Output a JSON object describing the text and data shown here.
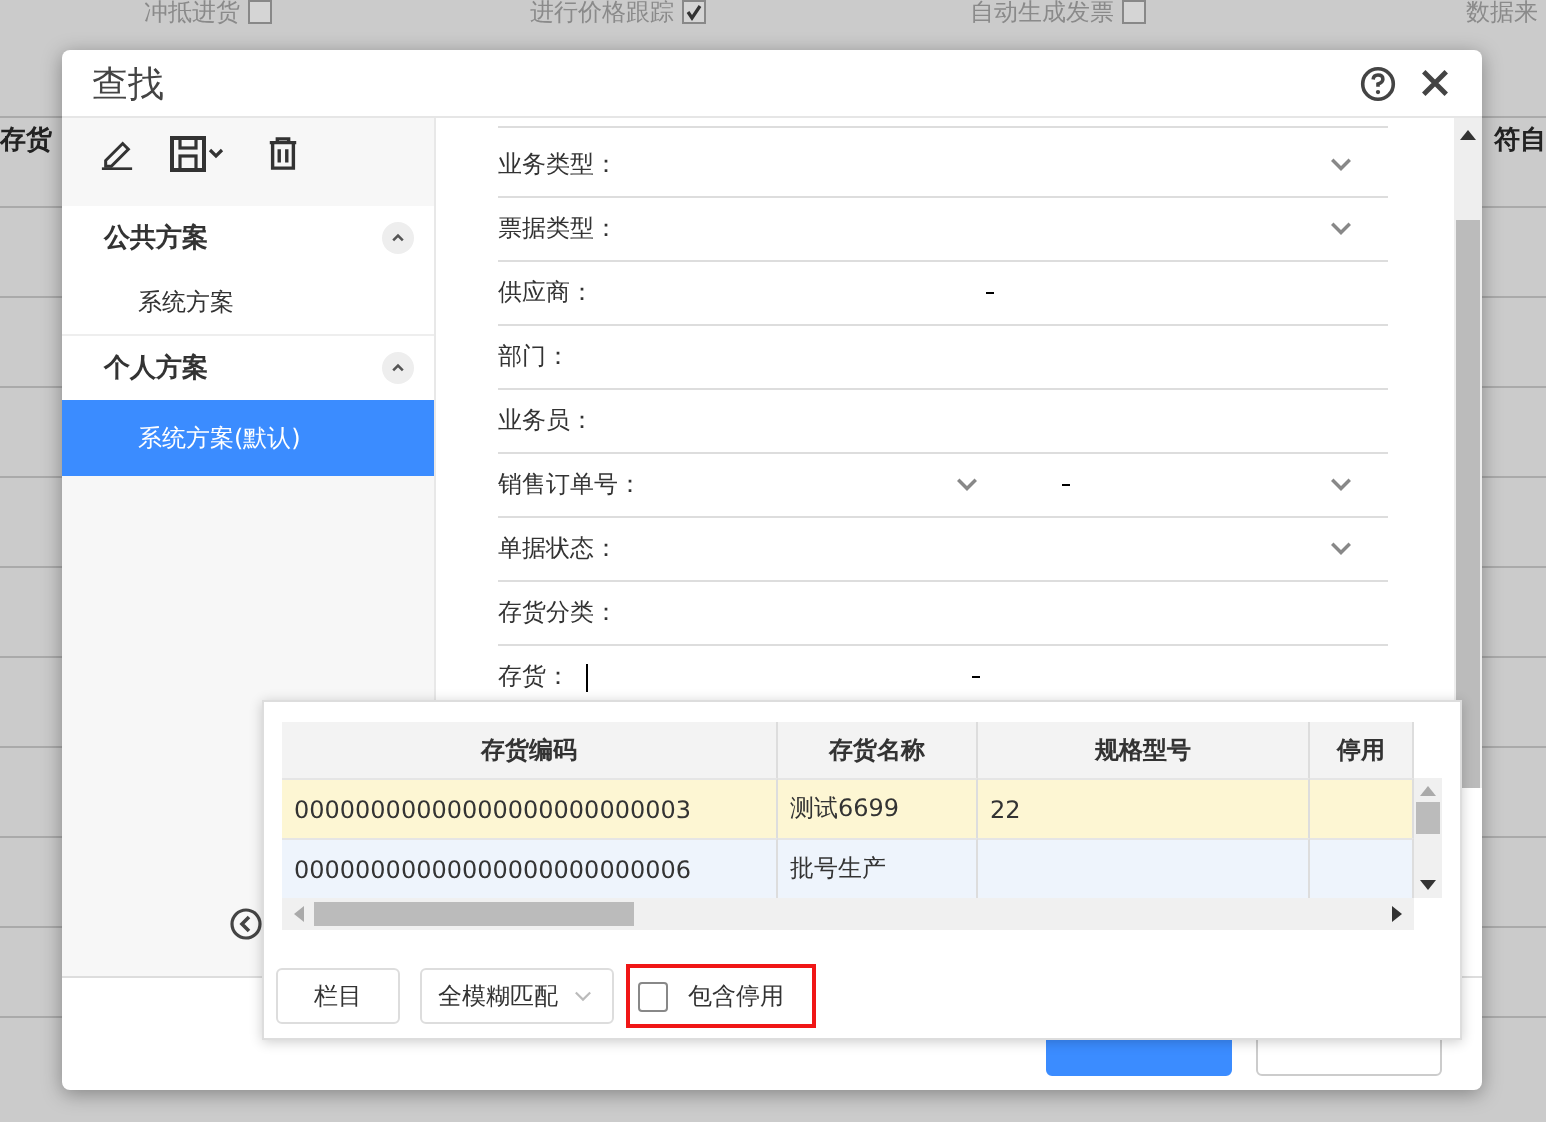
{
  "background": {
    "options": [
      {
        "label": "冲抵进货",
        "checked": false
      },
      {
        "label": "进行价格跟踪",
        "checked": true
      },
      {
        "label": "自动生成发票",
        "checked": false
      },
      {
        "label": "数据来"
      }
    ],
    "columns": [
      "存货",
      "符自"
    ]
  },
  "dialog": {
    "title": "查找",
    "sidebar": {
      "groups": [
        {
          "title": "公共方案",
          "expanded": true,
          "items": [
            {
              "label": "系统方案",
              "selected": false
            }
          ]
        },
        {
          "title": "个人方案",
          "expanded": true,
          "items": [
            {
              "label": "系统方案(默认)",
              "selected": true
            }
          ]
        }
      ]
    },
    "fields": [
      {
        "label": "业务类型：",
        "kind": "select"
      },
      {
        "label": "票据类型：",
        "kind": "select"
      },
      {
        "label": "供应商：",
        "kind": "range"
      },
      {
        "label": "部门：",
        "kind": "text"
      },
      {
        "label": "业务员：",
        "kind": "text"
      },
      {
        "label": "销售订单号：",
        "kind": "select-range"
      },
      {
        "label": "单据状态：",
        "kind": "select"
      },
      {
        "label": "存货分类：",
        "kind": "text"
      },
      {
        "label": "存货：",
        "kind": "focused-range"
      }
    ],
    "footer_buttons": [
      {
        "kind": "primary"
      },
      {
        "kind": "default"
      }
    ]
  },
  "popup": {
    "columns": [
      "存货编码",
      "存货名称",
      "规格型号",
      "停用"
    ],
    "rows": [
      {
        "cells": [
          "00000000000000000000000003",
          "测试6699",
          "22"
        ],
        "selected": true
      },
      {
        "cells": [
          "00000000000000000000000006",
          "批号生产"
        ],
        "selected": false
      }
    ],
    "columns_button": "栏目",
    "match_mode": "全模糊匹配",
    "include_disabled": {
      "label": "包含停用",
      "checked": false,
      "highlighted": true
    }
  }
}
